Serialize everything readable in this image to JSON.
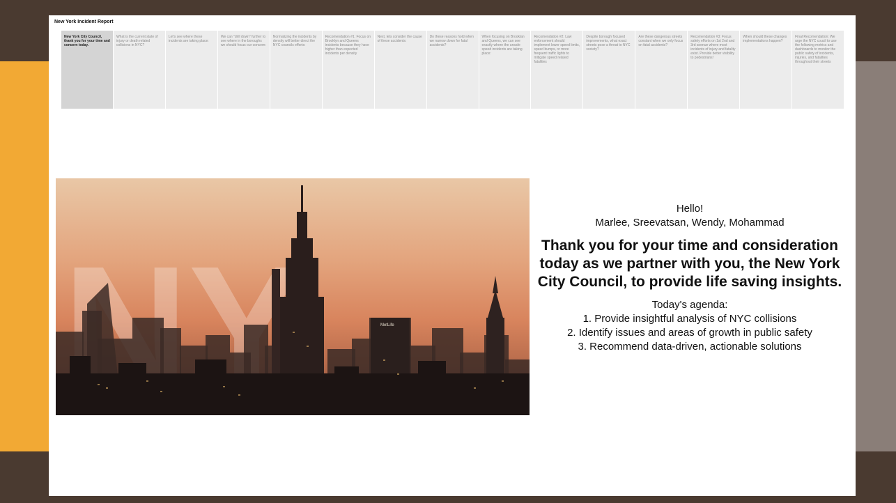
{
  "report": {
    "title": "New York Incident Report"
  },
  "story_points": [
    {
      "label": "New York City Council, thank you for your time and concern today.",
      "active": true
    },
    {
      "label": "What is the current state of injury or death related collisions in NYC?",
      "active": false
    },
    {
      "label": "Let's see where these incidents are taking place:",
      "active": false
    },
    {
      "label": "We can \"drill down\" further to see where in the boroughs we should focus our concern:",
      "active": false
    },
    {
      "label": "Normalizing the incidents by density will better direct the NYC councils efforts:",
      "active": false
    },
    {
      "label": "Recomendation #1: Focus on Brooklyn and Queens incidents because they have higher than expected incidents per density",
      "active": false
    },
    {
      "label": "Next, lets consider the cause of these accidents:",
      "active": false
    },
    {
      "label": "Do these reasons hold when we narrow down for fatal accidents?",
      "active": false
    },
    {
      "label": "When focusing on Brooklan and Queens, we can see exactly where the unsafe speed incidents are taking place:",
      "active": false
    },
    {
      "label": "Recomendation #2: Law enforcement should implement lower speed limits, speed bumps, or more frequent traffic lights to mitigate speed related fatalities",
      "active": false
    },
    {
      "label": "Despite borough focused improvements, what exact streets pose a threat to NYC society?",
      "active": false
    },
    {
      "label": "Are these dangerous streets constant when we only focus on fatal accidents?",
      "active": false
    },
    {
      "label": "Recomendation #3: Focus safety efforts on 1st 2nd and 3rd avenue where most incidents of injury and fatality exist. Provide better visibility to pedestrians!",
      "active": false
    },
    {
      "label": "When should these changes implementations happen?",
      "active": false
    },
    {
      "label": "Final Recomendation: We urge the NYC coucil to use the following metrics and dashboards to monitor the public safety of incidents, injuries, and fatalities throughout their streets",
      "active": false
    }
  ],
  "hero": {
    "overlay_text": "NY",
    "sign_text": "MetLife"
  },
  "intro": {
    "greeting": "Hello!",
    "names": "Marlee, Sreevatsan, Wendy, Mohammad",
    "headline": "Thank you for your time and consideration today as we partner with you, the New York City Council, to provide life saving insights.",
    "agenda_title": "Today's agenda:",
    "agenda_items": [
      "1. Provide insightful analysis of NYC collisions",
      "2. Identify issues and areas of growth in public safety",
      "3. Recommend data-driven, actionable solutions"
    ]
  },
  "colors": {
    "frame_dark": "#4a3a30",
    "frame_orange": "#f2a934",
    "frame_gray": "#8a7e78",
    "tab_active": "#d4d4d4",
    "tab_inactive": "#ececec"
  }
}
